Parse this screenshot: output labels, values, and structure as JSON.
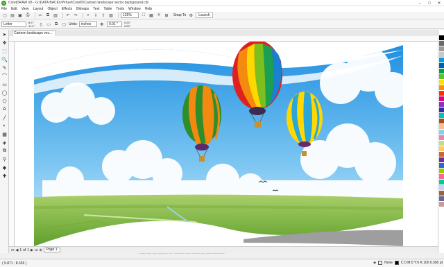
{
  "app": {
    "title": "CorelDRAW X8 - G:\\DATA BACKUP\\rfuel\\CorelD\\Cartoon landscape vector background.cdr",
    "window_controls": [
      "–",
      "□",
      "✕"
    ]
  },
  "menu": [
    "File",
    "Edit",
    "View",
    "Layout",
    "Object",
    "Effects",
    "Bitmaps",
    "Text",
    "Table",
    "Tools",
    "Window",
    "Help"
  ],
  "toolbar": {
    "zoom": "125%",
    "snap_label": "Snap To",
    "launch_label": "Launch"
  },
  "property_bar": {
    "page_size": "Letter",
    "width": "8.5 \"",
    "height": "11.0 \"",
    "units_label": "Units:",
    "units": "inches",
    "nudge": "0.01 \"",
    "dup_x": "0.25 \"",
    "dup_y": "0.25 \""
  },
  "document_tab": "Cartoon landscape vec...",
  "page": {
    "current": "1",
    "of_label": "of",
    "total": "1",
    "tab": "Page 1"
  },
  "canvas_hint": "Drag colors (or objects) here to store these colors with your document",
  "status": {
    "coords": "( 9.871 ; 8.336 )",
    "fill_label": "None",
    "outline_label": "C:0 M:0 Y:0 K:100  0.500 pt"
  },
  "palette_colors": [
    "#ffffff",
    "#000000",
    "#6a6a6a",
    "#9a9a9a",
    "#c8c8c8",
    "#00a0e0",
    "#0060b0",
    "#00a050",
    "#60c030",
    "#ffe000",
    "#ff9000",
    "#ff3000",
    "#e00080",
    "#9030c0",
    "#3030a0",
    "#00c0c0",
    "#a05020",
    "#f0c090",
    "#80d0f0",
    "#f080b0",
    "#c0e080",
    "#ffcc66",
    "#cc6633",
    "#663399",
    "#3366cc",
    "#99cc00",
    "#ff6699",
    "#00cc99",
    "#ccccff",
    "#996633",
    "#666699",
    "#cc9999"
  ],
  "tools": [
    "➤",
    "✥",
    "⬚",
    "🔍",
    "✎",
    "⌒",
    "▭",
    "◯",
    "⬠",
    "A",
    "╱",
    "◐",
    "▦",
    "◈",
    "⧉",
    "⚲",
    "◆",
    "✚"
  ]
}
